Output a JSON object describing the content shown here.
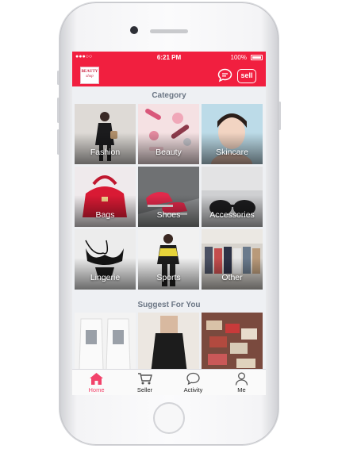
{
  "status_bar": {
    "signal": "●●●○○",
    "carrier": "",
    "time": "6:21 PM",
    "battery": "100%"
  },
  "header": {
    "logo_text_1": "BEAUTY",
    "logo_text_2": "shop",
    "sell_label": "sell"
  },
  "category": {
    "title": "Category",
    "items": [
      {
        "label": "Fashion"
      },
      {
        "label": "Beauty"
      },
      {
        "label": "Skincare"
      },
      {
        "label": "Bags"
      },
      {
        "label": "Shoes"
      },
      {
        "label": "Accessories"
      },
      {
        "label": "Lingerie"
      },
      {
        "label": "Sports"
      },
      {
        "label": "Other"
      }
    ]
  },
  "suggest": {
    "title": "Suggest For You"
  },
  "tabs": [
    {
      "label": "Home",
      "icon": "home-icon",
      "active": true
    },
    {
      "label": "Seller",
      "icon": "cart-icon",
      "active": false
    },
    {
      "label": "Activity",
      "icon": "chat-icon",
      "active": false
    },
    {
      "label": "Me",
      "icon": "person-icon",
      "active": false
    }
  ],
  "colors": {
    "brand": "#f11f3f",
    "active_tab": "#f2426a",
    "section_title": "#6b7684",
    "background": "#eef0f3"
  }
}
